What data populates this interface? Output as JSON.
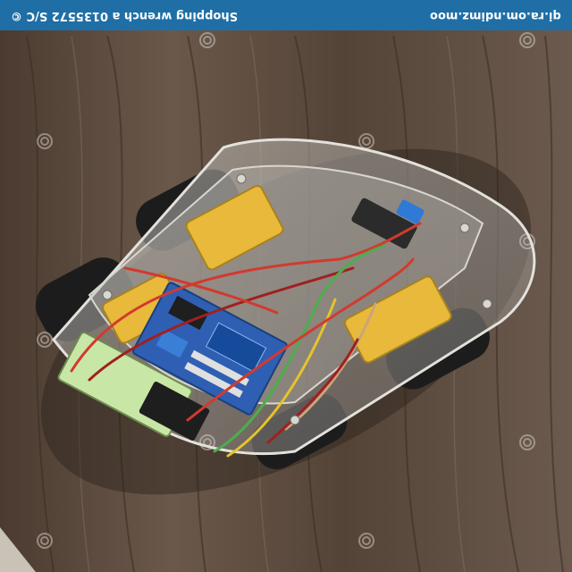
{
  "watermark": {
    "site": "qi.ra.om.ndimz.moo",
    "caption": "Shopping wrench a 0135572 S/C ©"
  },
  "colors": {
    "banner": "#1f6fa6",
    "wood": "#5a4a3e",
    "board": "#2f5fb3",
    "motor": "#e8b93a",
    "battery": "#c8e7a6",
    "wire_red": "#d23a2e",
    "wire_green": "#4cae4c",
    "wire_yellow": "#e5c42a",
    "wheel": "#1c1c1c"
  },
  "subject": {
    "icons": [
      "robot-car-chassis",
      "motor-driver-board",
      "battery-pack",
      "jumper-wires",
      "wheel",
      "distance-sensor"
    ]
  }
}
